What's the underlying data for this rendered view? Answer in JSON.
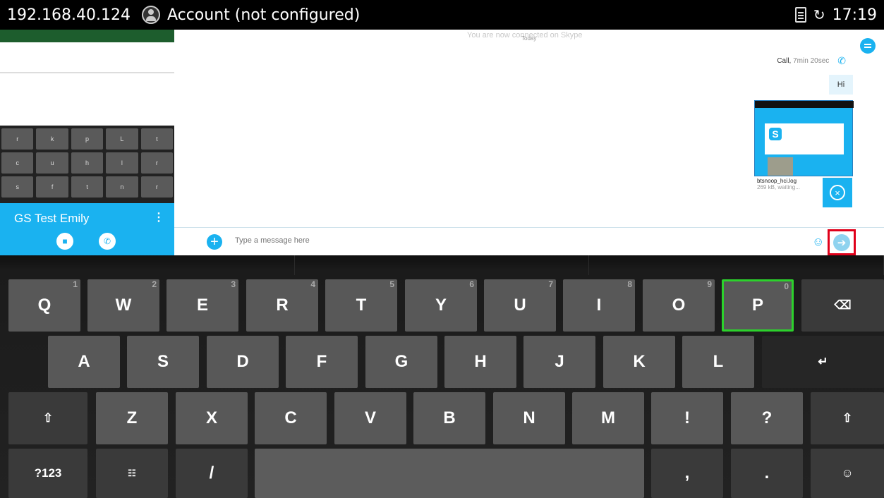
{
  "status_bar": {
    "ip": "192.168.40.124",
    "account": "Account (not configured)",
    "time": "17:19",
    "sync_icon": "↻"
  },
  "left_panel": {
    "back_icon": "‹",
    "contact_name": "GS Test Emily",
    "more_icon": "⋮",
    "mini_keys": [
      [
        "r",
        "k",
        "p",
        "L",
        "t"
      ],
      [
        "c",
        "u",
        "h",
        "l",
        "r"
      ],
      [
        "s",
        "f",
        "t",
        "n",
        "r"
      ]
    ]
  },
  "chat": {
    "banner": "You are now connected on Skype",
    "date_label": "Today",
    "call_label": "Call,",
    "call_duration": "7min 20sec",
    "message_text": "Hi",
    "file_name": "btsnoop_hci.log",
    "file_status": "269 kB, waiting...",
    "cancel_icon": "×"
  },
  "compose": {
    "placeholder": "Type a message here",
    "add_icon": "+",
    "emoji_icon": "☺",
    "send_icon": "➔"
  },
  "keyboard": {
    "row1": [
      {
        "label": "Q",
        "num": "1"
      },
      {
        "label": "W",
        "num": "2"
      },
      {
        "label": "E",
        "num": "3"
      },
      {
        "label": "R",
        "num": "4"
      },
      {
        "label": "T",
        "num": "5"
      },
      {
        "label": "Y",
        "num": "6"
      },
      {
        "label": "U",
        "num": "7"
      },
      {
        "label": "I",
        "num": "8"
      },
      {
        "label": "O",
        "num": "9"
      },
      {
        "label": "P",
        "num": "0"
      }
    ],
    "backspace": "⌫",
    "row2": [
      "A",
      "S",
      "D",
      "F",
      "G",
      "H",
      "J",
      "K",
      "L"
    ],
    "enter": "↵",
    "shift": "⇧",
    "row3": [
      "Z",
      "X",
      "C",
      "V",
      "B",
      "N",
      "M",
      "!",
      "?"
    ],
    "symbols": "?123",
    "settings_icon": "☷",
    "slash": "/",
    "comma": ",",
    "period": ".",
    "emoji": "☺",
    "selected_key": "P"
  }
}
